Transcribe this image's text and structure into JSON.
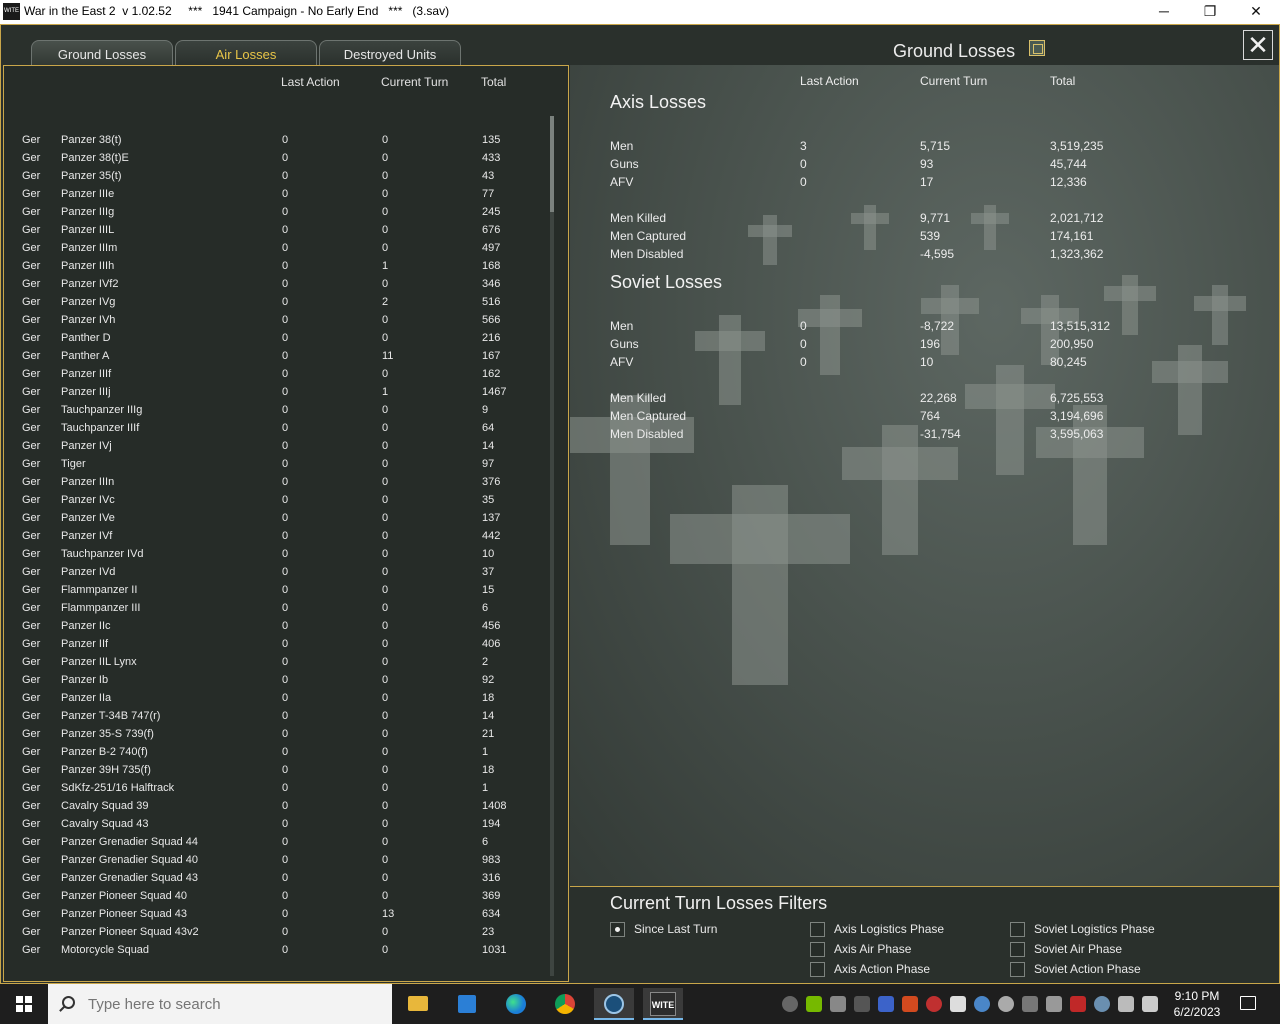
{
  "window": {
    "title": "War in the East 2  v 1.02.52     ***   1941 Campaign - No Early End   ***   (3.sav)",
    "icon_text": "WITE",
    "minimize": "─",
    "maximize": "❐",
    "close": "✕"
  },
  "tabs": [
    {
      "label": "Ground Losses"
    },
    {
      "label": "Air Losses"
    },
    {
      "label": "Destroyed Units"
    }
  ],
  "header": {
    "title": "Ground Losses",
    "close": "✕"
  },
  "left_table": {
    "columns": [
      "Last Action",
      "Current Turn",
      "Total"
    ],
    "rows": [
      [
        "Ger",
        "Panzer 38(t)",
        "0",
        "0",
        "135"
      ],
      [
        "Ger",
        "Panzer 38(t)E",
        "0",
        "0",
        "433"
      ],
      [
        "Ger",
        "Panzer 35(t)",
        "0",
        "0",
        "43"
      ],
      [
        "Ger",
        "Panzer IIIe",
        "0",
        "0",
        "77"
      ],
      [
        "Ger",
        "Panzer IIIg",
        "0",
        "0",
        "245"
      ],
      [
        "Ger",
        "Panzer IIIL",
        "0",
        "0",
        "676"
      ],
      [
        "Ger",
        "Panzer IIIm",
        "0",
        "0",
        "497"
      ],
      [
        "Ger",
        "Panzer IIIh",
        "0",
        "1",
        "168"
      ],
      [
        "Ger",
        "Panzer IVf2",
        "0",
        "0",
        "346"
      ],
      [
        "Ger",
        "Panzer IVg",
        "0",
        "2",
        "516"
      ],
      [
        "Ger",
        "Panzer IVh",
        "0",
        "0",
        "566"
      ],
      [
        "Ger",
        "Panther D",
        "0",
        "0",
        "216"
      ],
      [
        "Ger",
        "Panther A",
        "0",
        "11",
        "167"
      ],
      [
        "Ger",
        "Panzer IIIf",
        "0",
        "0",
        "162"
      ],
      [
        "Ger",
        "Panzer IIIj",
        "0",
        "1",
        "1467"
      ],
      [
        "Ger",
        "Tauchpanzer IIIg",
        "0",
        "0",
        "9"
      ],
      [
        "Ger",
        "Tauchpanzer IIIf",
        "0",
        "0",
        "64"
      ],
      [
        "Ger",
        "Panzer IVj",
        "0",
        "0",
        "14"
      ],
      [
        "Ger",
        "Tiger",
        "0",
        "0",
        "97"
      ],
      [
        "Ger",
        "Panzer IIIn",
        "0",
        "0",
        "376"
      ],
      [
        "Ger",
        "Panzer IVc",
        "0",
        "0",
        "35"
      ],
      [
        "Ger",
        "Panzer IVe",
        "0",
        "0",
        "137"
      ],
      [
        "Ger",
        "Panzer IVf",
        "0",
        "0",
        "442"
      ],
      [
        "Ger",
        "Tauchpanzer IVd",
        "0",
        "0",
        "10"
      ],
      [
        "Ger",
        "Panzer IVd",
        "0",
        "0",
        "37"
      ],
      [
        "Ger",
        "Flammpanzer II",
        "0",
        "0",
        "15"
      ],
      [
        "Ger",
        "Flammpanzer III",
        "0",
        "0",
        "6"
      ],
      [
        "Ger",
        "Panzer IIc",
        "0",
        "0",
        "456"
      ],
      [
        "Ger",
        "Panzer IIf",
        "0",
        "0",
        "406"
      ],
      [
        "Ger",
        "Panzer IIL Lynx",
        "0",
        "0",
        "2"
      ],
      [
        "Ger",
        "Panzer Ib",
        "0",
        "0",
        "92"
      ],
      [
        "Ger",
        "Panzer IIa",
        "0",
        "0",
        "18"
      ],
      [
        "Ger",
        "Panzer T-34B 747(r)",
        "0",
        "0",
        "14"
      ],
      [
        "Ger",
        "Panzer 35-S 739(f)",
        "0",
        "0",
        "21"
      ],
      [
        "Ger",
        "Panzer B-2 740(f)",
        "0",
        "0",
        "1"
      ],
      [
        "Ger",
        "Panzer 39H 735(f)",
        "0",
        "0",
        "18"
      ],
      [
        "Ger",
        "SdKfz-251/16 Halftrack",
        "0",
        "0",
        "1"
      ],
      [
        "Ger",
        "Cavalry Squad 39",
        "0",
        "0",
        "1408"
      ],
      [
        "Ger",
        "Cavalry Squad 43",
        "0",
        "0",
        "194"
      ],
      [
        "Ger",
        "Panzer Grenadier Squad 44",
        "0",
        "0",
        "6"
      ],
      [
        "Ger",
        "Panzer Grenadier Squad 40",
        "0",
        "0",
        "983"
      ],
      [
        "Ger",
        "Panzer Grenadier Squad 43",
        "0",
        "0",
        "316"
      ],
      [
        "Ger",
        "Panzer Pioneer Squad 40",
        "0",
        "0",
        "369"
      ],
      [
        "Ger",
        "Panzer Pioneer Squad 43",
        "0",
        "13",
        "634"
      ],
      [
        "Ger",
        "Panzer Pioneer Squad 43v2",
        "0",
        "0",
        "23"
      ],
      [
        "Ger",
        "Motorcycle Squad",
        "0",
        "0",
        "1031"
      ]
    ]
  },
  "summary": {
    "columns": [
      "Last Action",
      "Current Turn",
      "Total"
    ],
    "axis": {
      "title": "Axis Losses",
      "rows": [
        [
          "Men",
          "3",
          "5,715",
          "3,519,235"
        ],
        [
          "Guns",
          "0",
          "93",
          "45,744"
        ],
        [
          "AFV",
          "0",
          "17",
          "12,336"
        ]
      ],
      "detail": [
        [
          "Men Killed",
          "9,771",
          "2,021,712"
        ],
        [
          "Men Captured",
          "539",
          "174,161"
        ],
        [
          "Men Disabled",
          "-4,595",
          "1,323,362"
        ]
      ]
    },
    "soviet": {
      "title": "Soviet Losses",
      "rows": [
        [
          "Men",
          "0",
          "-8,722",
          "13,515,312"
        ],
        [
          "Guns",
          "0",
          "196",
          "200,950"
        ],
        [
          "AFV",
          "0",
          "10",
          "80,245"
        ]
      ],
      "detail": [
        [
          "Men Killed",
          "22,268",
          "6,725,553"
        ],
        [
          "Men Captured",
          "764",
          "3,194,696"
        ],
        [
          "Men Disabled",
          "-31,754",
          "3,595,063"
        ]
      ]
    }
  },
  "filters": {
    "title": "Current Turn Losses Filters",
    "options": [
      {
        "label": "Since Last Turn",
        "checked": true
      },
      {
        "label": "Axis Logistics Phase",
        "checked": false
      },
      {
        "label": "Axis Air Phase",
        "checked": false
      },
      {
        "label": "Axis Action Phase",
        "checked": false
      },
      {
        "label": "Soviet Logistics Phase",
        "checked": false
      },
      {
        "label": "Soviet Air Phase",
        "checked": false
      },
      {
        "label": "Soviet Action Phase",
        "checked": false
      }
    ]
  },
  "taskbar": {
    "search_placeholder": "Type here to search",
    "time": "9:10 PM",
    "date": "6/2/2023",
    "wite_label": "WITE"
  }
}
